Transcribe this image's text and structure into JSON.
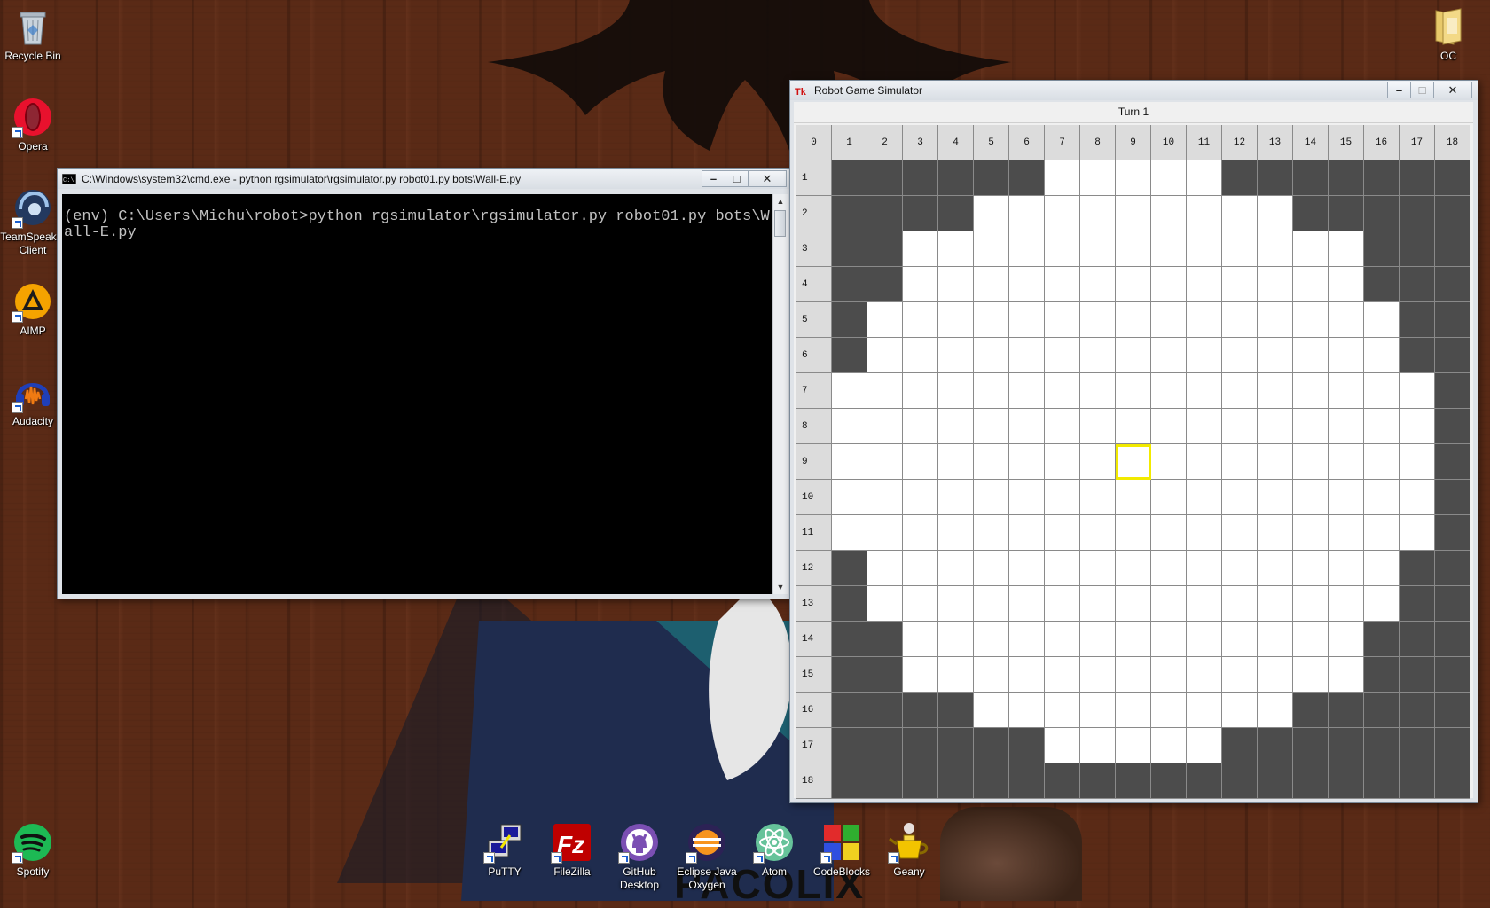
{
  "desktop": {
    "icons_left": [
      {
        "label": "Recycle Bin",
        "icon": "recycle-bin-icon"
      },
      {
        "label": "Opera",
        "icon": "opera-icon"
      },
      {
        "label": "TeamSpeak 3\nClient",
        "icon": "teamspeak-icon"
      },
      {
        "label": "AIMP",
        "icon": "aimp-icon"
      },
      {
        "label": "Audacity",
        "icon": "audacity-icon"
      },
      {
        "label": "Spotify",
        "icon": "spotify-icon"
      }
    ],
    "icons_right": [
      {
        "label": "OC",
        "icon": "folder-icon"
      }
    ],
    "dock": [
      {
        "label": "PuTTY",
        "icon": "putty-icon"
      },
      {
        "label": "FileZilla",
        "icon": "filezilla-icon"
      },
      {
        "label": "GitHub\nDesktop",
        "icon": "github-icon"
      },
      {
        "label": "Eclipse Java\nOxygen",
        "icon": "eclipse-icon"
      },
      {
        "label": "Atom",
        "icon": "atom-icon"
      },
      {
        "label": "CodeBlocks",
        "icon": "codeblocks-icon"
      },
      {
        "label": "Geany",
        "icon": "geany-icon"
      }
    ],
    "wallpaper_text": "PACOLIX"
  },
  "cmd_window": {
    "title": "C:\\Windows\\system32\\cmd.exe - python  rgsimulator\\rgsimulator.py robot01.py bots\\Wall-E.py",
    "output": "(env) C:\\Users\\Michu\\robot>python rgsimulator\\rgsimulator.py robot01.py bots\\Wall-E.py"
  },
  "simulator": {
    "title": "Robot Game Simulator",
    "turn_label": "Turn 1",
    "size": 19,
    "colors": {
      "obstacle": "#4c4c4c",
      "normal": "#ffffff",
      "header": "#dcdcdc",
      "robot_outline": "#f2ea00"
    },
    "walkable_ranges": [
      [
        1,
        [
          7,
          11
        ]
      ],
      [
        2,
        [
          5,
          13
        ]
      ],
      [
        3,
        [
          3,
          15
        ]
      ],
      [
        4,
        [
          3,
          15
        ]
      ],
      [
        5,
        [
          2,
          16
        ]
      ],
      [
        6,
        [
          2,
          16
        ]
      ],
      [
        7,
        [
          1,
          17
        ]
      ],
      [
        8,
        [
          1,
          17
        ]
      ],
      [
        9,
        [
          1,
          17
        ]
      ],
      [
        10,
        [
          1,
          17
        ]
      ],
      [
        11,
        [
          1,
          17
        ]
      ],
      [
        12,
        [
          2,
          16
        ]
      ],
      [
        13,
        [
          2,
          16
        ]
      ],
      [
        14,
        [
          3,
          15
        ]
      ],
      [
        15,
        [
          3,
          15
        ]
      ],
      [
        16,
        [
          5,
          13
        ]
      ],
      [
        17,
        [
          7,
          11
        ]
      ]
    ],
    "selected_cell": {
      "col": 9,
      "row": 9
    }
  },
  "window_controls": {
    "minimize": "–",
    "maximize": "□",
    "close": "✕"
  }
}
